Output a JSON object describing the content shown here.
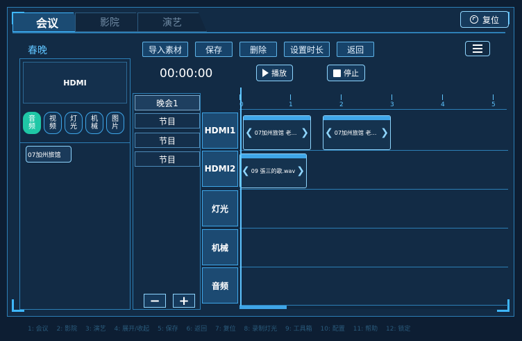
{
  "tabs": [
    {
      "label": "会议",
      "active": true
    },
    {
      "label": "影院",
      "active": false
    },
    {
      "label": "演艺",
      "active": false
    }
  ],
  "reset_label": "复位",
  "title": "春晚",
  "toolbar": [
    "导入素材",
    "保存",
    "删除",
    "设置时长",
    "返回"
  ],
  "preview_label": "HDMI",
  "categories": [
    {
      "label": "音频",
      "active": true
    },
    {
      "label": "视频",
      "active": false
    },
    {
      "label": "灯光",
      "active": false
    },
    {
      "label": "机械",
      "active": false
    },
    {
      "label": "图片",
      "active": false
    }
  ],
  "media_items": [
    "07加州旅馆"
  ],
  "timecode": "00:00:00",
  "play_label": "播放",
  "stop_label": "停止",
  "programs": [
    {
      "label": "晚会1",
      "active": true
    },
    {
      "label": "节目",
      "active": false
    },
    {
      "label": "节目",
      "active": false
    },
    {
      "label": "节目",
      "active": false
    }
  ],
  "add_label": "+",
  "remove_label": "−",
  "tracks": [
    "HDMI1",
    "HDMI2",
    "灯光",
    "机械",
    "音频"
  ],
  "ruler": {
    "ticks": [
      "0",
      "1",
      "2",
      "3",
      "4",
      "5"
    ]
  },
  "clips": [
    {
      "track": "HDMI1",
      "name": "07加州旅馆 老鹰..."
    },
    {
      "track": "HDMI1",
      "name": "07加州旅馆 老鹰..."
    },
    {
      "track": "HDMI2",
      "name": "09 張三的歌.wav"
    }
  ],
  "shortcuts": [
    "1: 会议",
    "2: 影院",
    "3: 演艺",
    "4: 展开/收起",
    "5: 保存",
    "6: 返回",
    "7: 复位",
    "8: 录制灯光",
    "9: 工具箱",
    "10: 配置",
    "11: 帮助",
    "12: 锁定"
  ],
  "colors": {
    "accent": "#3fb7ff",
    "active_category": "#1fc7a6",
    "background": "#0d1e33"
  }
}
